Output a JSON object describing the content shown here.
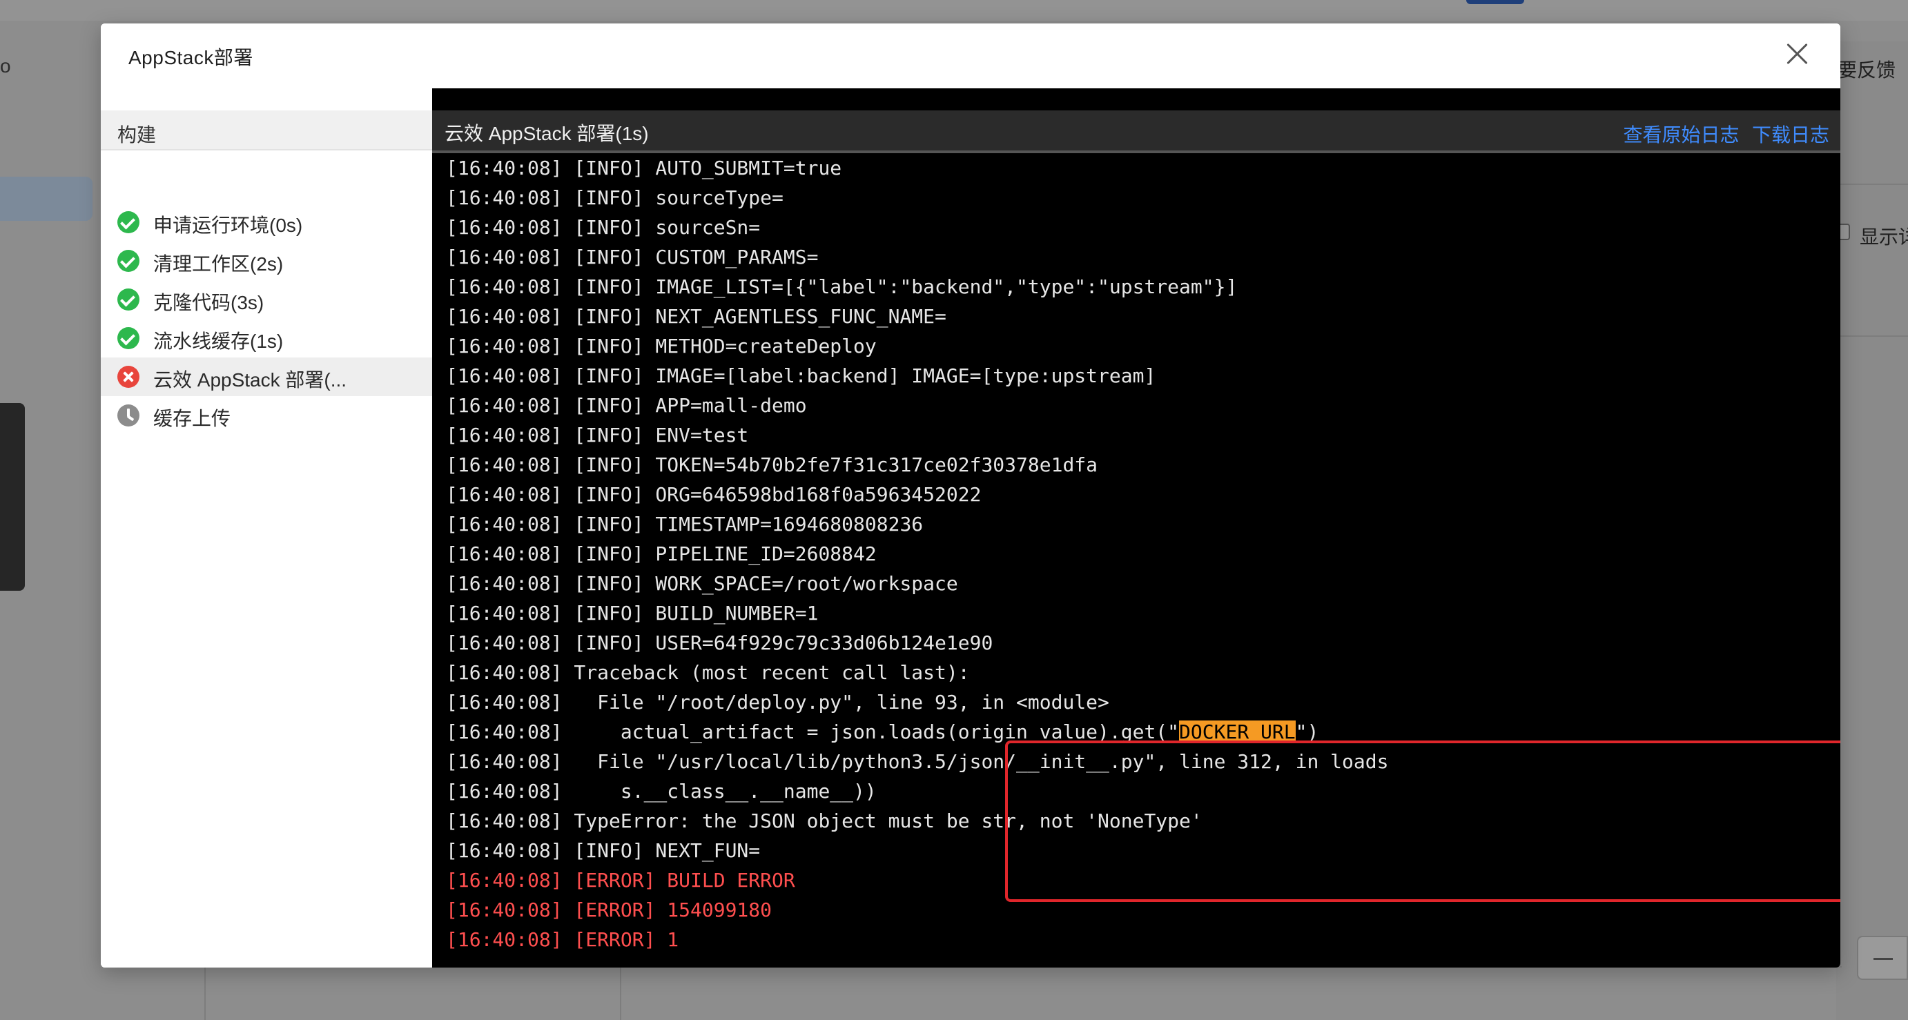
{
  "background": {
    "left_text": "o",
    "right_feedback": "要反馈",
    "right_show": "显示详"
  },
  "modal": {
    "title": "AppStack部署",
    "close_icon": "close-icon"
  },
  "sidebar": {
    "header": "构建",
    "steps": [
      {
        "label": "申请运行环境(0s)",
        "status": "success",
        "icon": "check-circle-icon"
      },
      {
        "label": "清理工作区(2s)",
        "status": "success",
        "icon": "check-circle-icon"
      },
      {
        "label": "克隆代码(3s)",
        "status": "success",
        "icon": "check-circle-icon"
      },
      {
        "label": "流水线缓存(1s)",
        "status": "success",
        "icon": "check-circle-icon"
      },
      {
        "label": "云效 AppStack 部署(...",
        "status": "failed",
        "icon": "error-circle-icon"
      },
      {
        "label": "缓存上传",
        "status": "pending",
        "icon": "clock-icon"
      }
    ]
  },
  "log": {
    "title": "云效 AppStack 部署(1s)",
    "view_raw": "查看原始日志",
    "download": "下载日志",
    "lines": [
      "[16:40:08] [INFO] AUTO_SUBMIT=true",
      "[16:40:08] [INFO] sourceType=",
      "[16:40:08] [INFO] sourceSn=",
      "[16:40:08] [INFO] CUSTOM_PARAMS=",
      "[16:40:08] [INFO] IMAGE_LIST=[{\"label\":\"backend\",\"type\":\"upstream\"}]",
      "[16:40:08] [INFO] NEXT_AGENTLESS_FUNC_NAME=",
      "[16:40:08] [INFO] METHOD=createDeploy",
      "[16:40:08] [INFO] IMAGE=[label:backend] IMAGE=[type:upstream]",
      "[16:40:08] [INFO] APP=mall-demo",
      "[16:40:08] [INFO] ENV=test",
      "[16:40:08] [INFO] TOKEN=54b70b2fe7f31c317ce02f30378e1dfa",
      "[16:40:08] [INFO] ORG=646598bd168f0a5963452022",
      "[16:40:08] [INFO] TIMESTAMP=1694680808236",
      "[16:40:08] [INFO] PIPELINE_ID=2608842",
      "[16:40:08] [INFO] WORK_SPACE=/root/workspace",
      "[16:40:08] [INFO] BUILD_NUMBER=1",
      "[16:40:08] [INFO] USER=64f929c79c33d06b124e1e90",
      "[16:40:08] Traceback (most recent call last):",
      "[16:40:08]   File \"/root/deploy.py\", line 93, in <module>",
      "[16:40:08]     actual_artifact = json.loads(origin_value).get(\"",
      "[16:40:08]   File \"/usr/local/lib/python3.5/json/__init__.py\", line 312, in loads",
      "[16:40:08]     s.__class__.__name__))",
      "[16:40:08] TypeError: the JSON object must be str, not 'NoneType'",
      "[16:40:08] [INFO] NEXT_FUN=",
      "[16:40:08] [ERROR] BUILD ERROR",
      "[16:40:08] [ERROR] 154099180",
      "[16:40:08] [ERROR] 1"
    ],
    "highlight_line": {
      "prefix": "[16:40:08]     actual_artifact = json.loads(origin_value).get(\"",
      "highlight": "DOCKER_URL",
      "suffix": "\")"
    },
    "colors": {
      "info": "#e6e6e6",
      "error": "#ff4f4f",
      "highlight_bg": "#f59a23",
      "link": "#3f8cff",
      "box": "#e0262b"
    }
  }
}
